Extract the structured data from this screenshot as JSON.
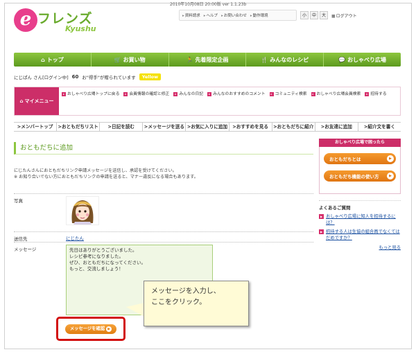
{
  "header": {
    "logo_mark": "e",
    "logo_jp": "フレンズ",
    "logo_en": "Kyushu",
    "date_version": "2010年10月08日 20:00版 ver 1.1.23b",
    "util_links": [
      "資料請求",
      "ヘルプ",
      "お問い合わせ",
      "動作環境"
    ],
    "font_sizes": [
      "小",
      "中",
      "大"
    ],
    "logout": "ログアウト"
  },
  "nav": {
    "items": [
      {
        "icon": "house-icon",
        "glyph": "⌂",
        "label": "トップ"
      },
      {
        "icon": "cart-icon",
        "glyph": "🛒",
        "label": "お買い物"
      },
      {
        "icon": "runner-icon",
        "glyph": "🏃",
        "label": "先着限定企画"
      },
      {
        "icon": "fork-knife-icon",
        "glyph": "🍴",
        "label": "みんなのレシピ"
      },
      {
        "icon": "speech-bubbles-icon",
        "glyph": "💬",
        "label": "おしゃべり広場"
      }
    ]
  },
  "user": {
    "name": "にじぱん",
    "status": "さん[ログイン中]",
    "points": "60",
    "points_note": "お\"得手\"が贈られています",
    "badge": "Yellow"
  },
  "mymenu": {
    "title": "マイメニュー",
    "links": [
      "おしゃべり広場トップに戻る",
      "会員情報の確認と修正",
      "みんなの日記",
      "みんなのおすすめのコメント",
      "コミュニティ検索",
      "おしゃべり広場会員検索",
      "招待する"
    ]
  },
  "subnav": {
    "items": [
      ">メンバートップ",
      ">おともだちリスト",
      ">日記を読む",
      ">メッセージを送る",
      ">お気に入りに追加",
      ">おすすめを見る",
      ">おともだちに紹介",
      ">お友達に追加",
      ">紹介文を書く"
    ]
  },
  "main": {
    "title": "おともだちに追加",
    "desc_line1": "にじたんさんにおともだちリンク申請メッセージを送信し、承認を受けてください。",
    "desc_line2": "※ お知り合いでない方におともだちリンクの申請を送ると、マナー違反になる場合もあります。",
    "photo_label": "写真",
    "dest_label": "送信先",
    "dest_value": "にじたん",
    "message_label": "メッセージ",
    "message_value": "先日はありがとうございました。\nレシピ参考になりました。\nぜひ、おともだちになってください。\nもっと、交流しましょう！",
    "confirm_button": "メッセージを確認"
  },
  "callout": {
    "line1": "メッセージを入力し、",
    "line2": "ここをクリック。"
  },
  "sidebar": {
    "head": "おしゃべり広場で困ったら",
    "btn1": "おともだちとは",
    "btn2": "おともだち機能の使い方",
    "faq_title": "よくあるご質問",
    "faq": [
      "おしゃべり広場に知人を招待するには？",
      "招待する人は生協の組合員でなくてはだめですか？"
    ],
    "more": "もっと見る"
  },
  "colors": {
    "nav_green": "#6aab2e",
    "menu_pink": "#cc2e68",
    "button_orange": "#e07d12",
    "highlight_red": "#d20e0e",
    "callout_yellow": "#fffbd6"
  }
}
